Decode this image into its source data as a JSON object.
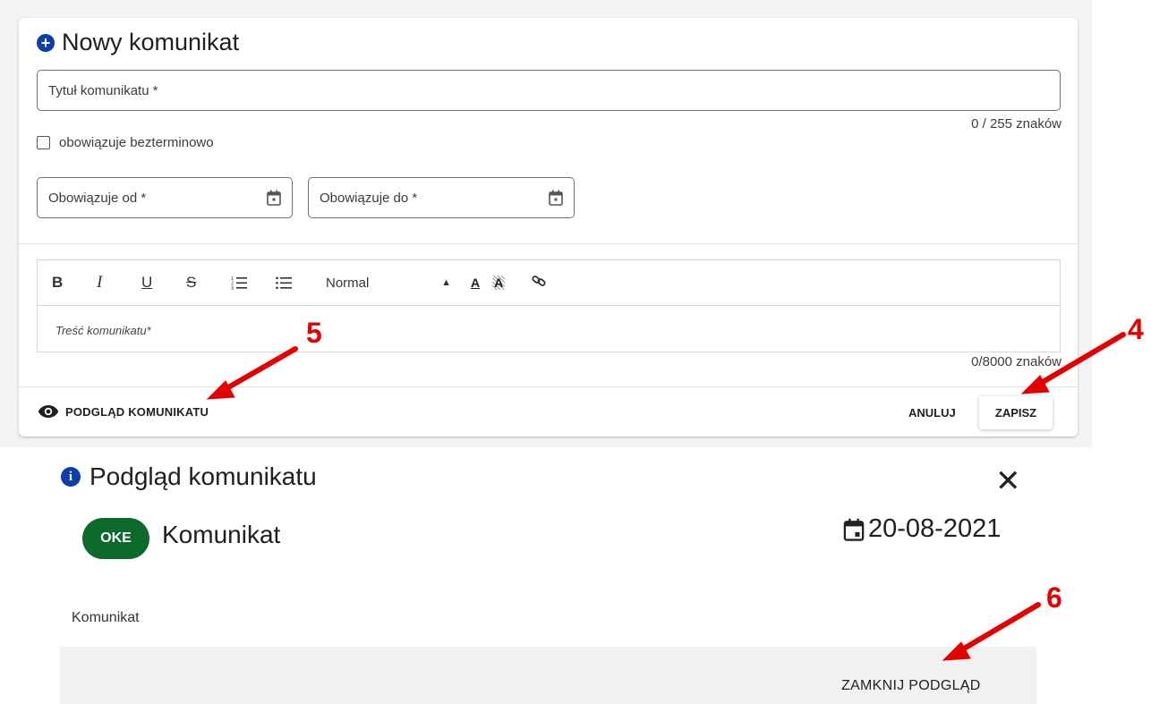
{
  "form": {
    "title": "Nowy komunikat",
    "title_placeholder": "Tytuł komunikatu *",
    "title_counter": "0 / 255 znaków",
    "checkbox_label": "obowiązuje bezterminowo",
    "date_from_label": "Obowiązuje od *",
    "date_to_label": "Obowiązuje do *",
    "editor": {
      "bold": "B",
      "italic": "I",
      "underline": "U",
      "strike": "S",
      "size_select": "Normal",
      "color_glyph": "A",
      "background_glyph": "A",
      "placeholder": "Treść komunikatu*"
    },
    "content_counter": "0/8000 znaków",
    "preview_button": "PODGLĄD KOMUNIKATU",
    "cancel_button": "ANULUJ",
    "save_button": "ZAPISZ"
  },
  "markers": {
    "m4": "4",
    "m5": "5",
    "m6": "6"
  },
  "preview": {
    "title": "Podgląd komunikatu",
    "badge": "OKE",
    "message_title": "Komunikat",
    "date": "20-08-2021",
    "body": "Komunikat",
    "close_button": "ZAMKNIJ PODGLĄD"
  },
  "colors": {
    "accent_blue": "#0b3ea8",
    "badge_green": "#0c6b2b",
    "annotation_red": "#e30000"
  },
  "icons": [
    "plus-circle-icon",
    "calendar-icon",
    "eye-icon",
    "info-icon",
    "close-icon",
    "link-icon",
    "numbered-list-icon",
    "bullet-list-icon"
  ]
}
